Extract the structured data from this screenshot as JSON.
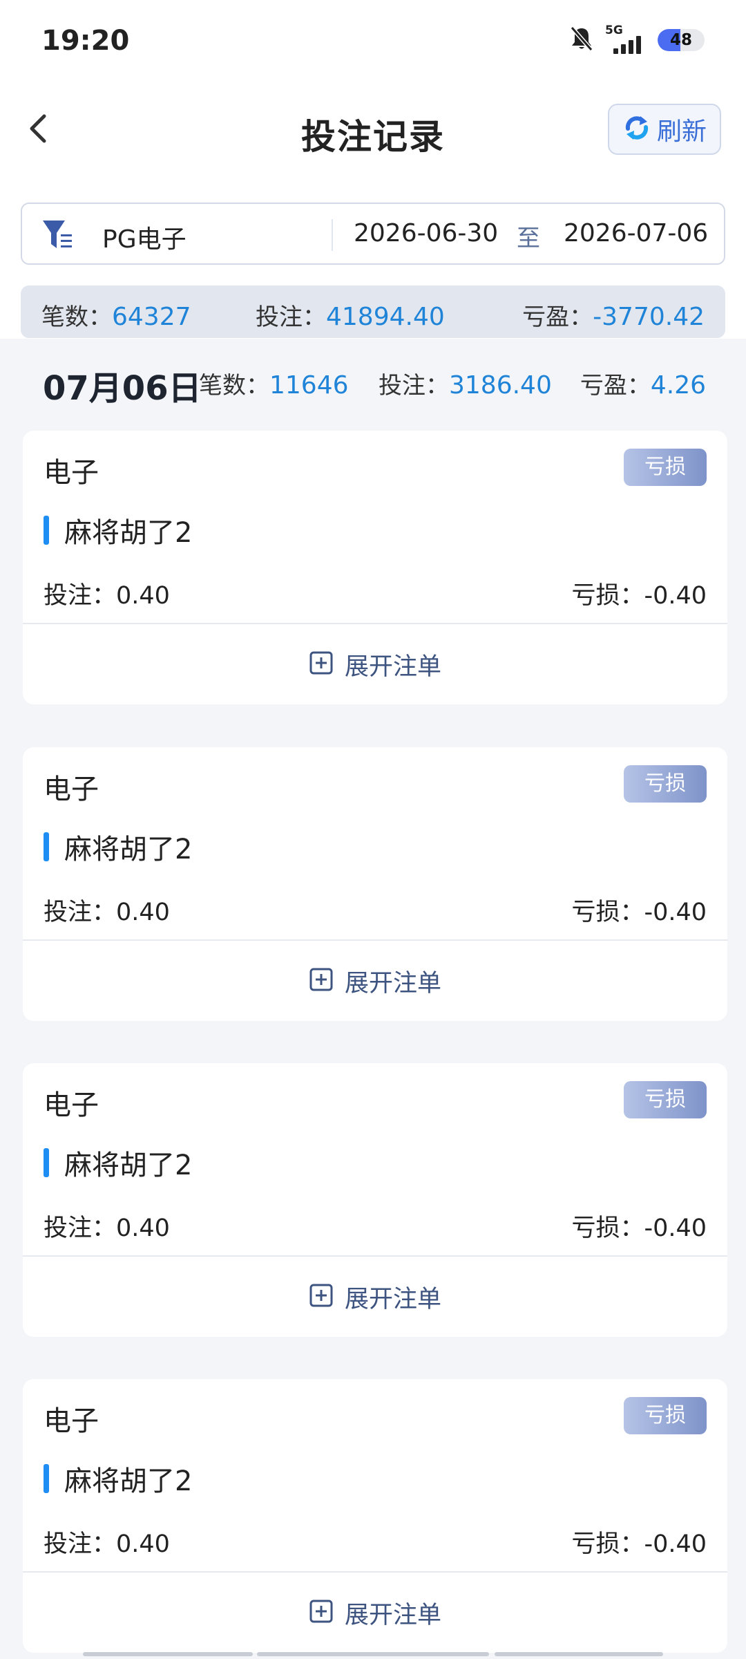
{
  "status_bar": {
    "time": "19:20",
    "network": "5G",
    "battery": "48",
    "battery_level": 0.48,
    "icons": [
      "bell-muted-icon",
      "signal-5g-icon",
      "battery-icon"
    ]
  },
  "header": {
    "title": "投注记录",
    "refresh_label": "刷新",
    "back_icon": "chevron-left-icon",
    "refresh_icon": "refresh-icon"
  },
  "filter": {
    "game": "PG电子",
    "date_start": "2026-06-30",
    "date_sep": "至",
    "date_end": "2026-07-06",
    "icon": "filter-icon"
  },
  "totals": {
    "count_label": "笔数：",
    "count": "64327",
    "bet_label": "投注：",
    "bet": "41894.40",
    "profit_label": "亏盈：",
    "profit": "-3770.42"
  },
  "day": {
    "date": "07月06日",
    "count_label": "笔数：",
    "count": "11646",
    "bet_label": "投注：",
    "bet": "3186.40",
    "profit_label": "亏盈：",
    "profit": "4.26"
  },
  "records": [
    {
      "category": "电子",
      "badge": "亏损",
      "game": "麻将胡了2",
      "bet": "投注：0.40",
      "result": "亏损：-0.40",
      "expand_label": "展开注单"
    },
    {
      "category": "电子",
      "badge": "亏损",
      "game": "麻将胡了2",
      "bet": "投注：0.40",
      "result": "亏损：-0.40",
      "expand_label": "展开注单"
    },
    {
      "category": "电子",
      "badge": "亏损",
      "game": "麻将胡了2",
      "bet": "投注：0.40",
      "result": "亏损：-0.40",
      "expand_label": "展开注单"
    },
    {
      "category": "电子",
      "badge": "亏损",
      "game": "麻将胡了2",
      "bet": "投注：0.40",
      "result": "亏损：-0.40",
      "expand_label": "展开注单"
    }
  ],
  "colors": {
    "accent_blue": "#1f84d8",
    "badge_from": "#b5c3e6",
    "badge_to": "#7e93c9",
    "filter_icon": "#3b5aa8"
  }
}
